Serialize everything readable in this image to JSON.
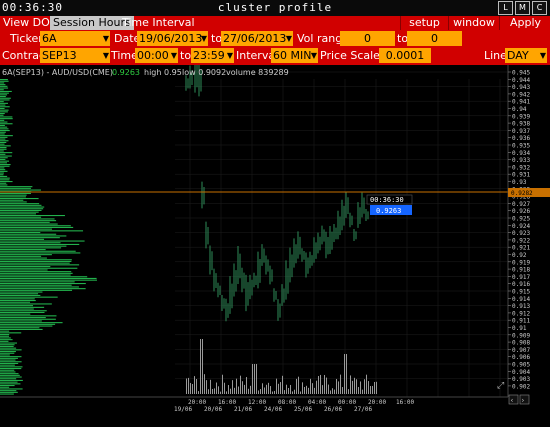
{
  "window": {
    "clock": "00:36:30",
    "title": "cluster profile",
    "buttons": [
      "L",
      "M",
      "C"
    ]
  },
  "menu": {
    "tabs": [
      "View DOM",
      "Session Hours",
      "Time Interval"
    ],
    "active_tab": "Session Hours",
    "right_buttons": [
      "setup",
      "window",
      "Apply"
    ]
  },
  "controls": {
    "ticker_label": "Ticker",
    "ticker": "6A",
    "date_label": "Date",
    "date_from": "19/06/2013",
    "to_label": "to",
    "date_to": "27/06/2013",
    "vol_range_label": "Vol range",
    "vol_from": "0",
    "vol_to": "0",
    "contract_label": "Contract",
    "contract": "SEP13",
    "time_label": "Time",
    "time_from": "00:00",
    "time_to": "23:59",
    "interval_label": "Interval",
    "interval": "60 MIN",
    "price_scale_label": "Price Scale",
    "price_scale": "0.0001",
    "line_label": "Line",
    "line": "DAY"
  },
  "chart": {
    "symbol": "6A(SEP13) - AUD/USD(CME)",
    "last": "0.9263",
    "high": "high 0.95",
    "low": "low 0.9092",
    "volume": "volume 839289",
    "time_tag": "00:36:30",
    "price_tag": "0.9263",
    "axis_marker": "0.9282",
    "y_ticks": [
      "0.945",
      "0.944",
      "0.943",
      "0.942",
      "0.941",
      "0.94",
      "0.939",
      "0.938",
      "0.937",
      "0.936",
      "0.935",
      "0.934",
      "0.933",
      "0.932",
      "0.931",
      "0.93",
      "0.929",
      "0.928",
      "0.927",
      "0.926",
      "0.925",
      "0.924",
      "0.923",
      "0.922",
      "0.921",
      "0.92",
      "0.919",
      "0.918",
      "0.917",
      "0.916",
      "0.915",
      "0.914",
      "0.913",
      "0.912",
      "0.911",
      "0.91",
      "0.909",
      "0.908",
      "0.907",
      "0.906",
      "0.905",
      "0.904",
      "0.903",
      "0.902"
    ],
    "x_labels_top": [
      "20:00",
      "16:00",
      "12:00",
      "08:00",
      "04:00",
      "00:00",
      "20:00",
      "16:00"
    ],
    "x_labels_bottom": [
      "19/06",
      "20/06",
      "21/06",
      "24/06",
      "25/06",
      "26/06",
      "27/06"
    ],
    "colors": {
      "profile": "#22b14c",
      "bars": "#2e8b57",
      "volume": "#999999",
      "price_line": "#c87000",
      "tag": "#1565ff",
      "grid": "#1e1e1e"
    }
  }
}
